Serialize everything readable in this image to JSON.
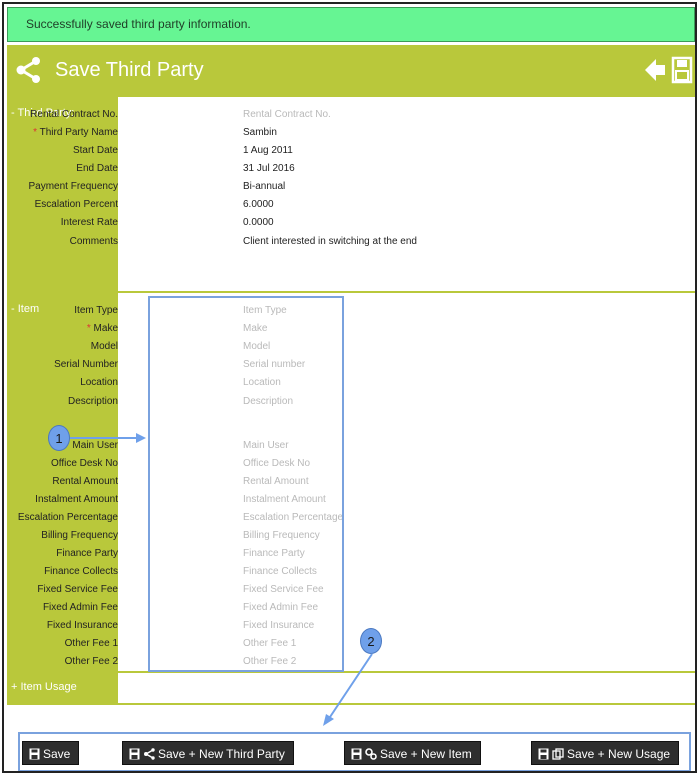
{
  "banner": {
    "message": "Successfully saved third party information."
  },
  "header": {
    "title": "Save Third Party"
  },
  "sections": {
    "third_party": {
      "label": "- Third Party:"
    },
    "item": {
      "label": "- Item"
    },
    "item_usage": {
      "label": "+ Item Usage"
    }
  },
  "third_party_fields": {
    "rental_contract": {
      "label": "Rental Contract No.",
      "value": "",
      "placeholder": "Rental Contract No."
    },
    "third_party_name": {
      "label": "Third Party Name",
      "value": "Sambin"
    },
    "start_date": {
      "label": "Start Date",
      "value": "1 Aug 2011"
    },
    "end_date": {
      "label": "End Date",
      "value": "31 Jul 2016"
    },
    "payment_frequency": {
      "label": "Payment Frequency",
      "value": "Bi-annual"
    },
    "escalation_percent": {
      "label": "Escalation Percent",
      "value": "6.0000"
    },
    "interest_rate": {
      "label": "Interest Rate",
      "value": "0.0000"
    },
    "comments": {
      "label": "Comments",
      "value": "Client interested in switching at the end"
    }
  },
  "item_fields": {
    "item_type": {
      "label": "Item Type",
      "placeholder": "Item Type"
    },
    "make": {
      "label": "Make",
      "placeholder": "Make"
    },
    "model": {
      "label": "Model",
      "placeholder": "Model"
    },
    "serial_number": {
      "label": "Serial Number",
      "placeholder": "Serial number"
    },
    "location": {
      "label": "Location",
      "placeholder": "Location"
    },
    "description": {
      "label": "Description",
      "placeholder": "Description"
    },
    "main_user": {
      "label": "Main User",
      "placeholder": "Main User"
    },
    "office_desk_no": {
      "label": "Office Desk No",
      "placeholder": "Office Desk No"
    },
    "rental_amount": {
      "label": "Rental Amount",
      "placeholder": "Rental Amount"
    },
    "instalment_amount": {
      "label": "Instalment Amount",
      "placeholder": "Instalment Amount"
    },
    "escalation_percentage": {
      "label": "Escalation Percentage",
      "placeholder": "Escalation Percentage"
    },
    "billing_frequency": {
      "label": "Billing Frequency",
      "placeholder": "Billing Frequency"
    },
    "finance_party": {
      "label": "Finance Party",
      "placeholder": "Finance Party"
    },
    "finance_collects": {
      "label": "Finance Collects",
      "placeholder": "Finance Collects"
    },
    "fixed_service_fee": {
      "label": "Fixed Service Fee",
      "placeholder": "Fixed Service Fee"
    },
    "fixed_admin_fee": {
      "label": "Fixed Admin Fee",
      "placeholder": "Fixed Admin Fee"
    },
    "fixed_insurance": {
      "label": "Fixed Insurance",
      "placeholder": "Fixed Insurance"
    },
    "other_fee_1": {
      "label": "Other Fee 1",
      "placeholder": "Other Fee 1"
    },
    "other_fee_2": {
      "label": "Other Fee 2",
      "placeholder": "Other Fee 2"
    }
  },
  "required_mark": "*",
  "annotations": {
    "one": "1",
    "two": "2"
  },
  "buttons": {
    "save": "Save",
    "save_new_third_party": "Save + New Third Party",
    "save_new_item": "Save + New Item",
    "save_new_usage": "Save + New Usage"
  },
  "icons": {
    "share": "share-icon",
    "back": "arrow-left-icon",
    "save": "floppy-disk-icon"
  },
  "colors": {
    "accent": "#b9c83b",
    "success": "#66f593",
    "highlight": "#7aa2de",
    "button": "#2e2e2e"
  }
}
